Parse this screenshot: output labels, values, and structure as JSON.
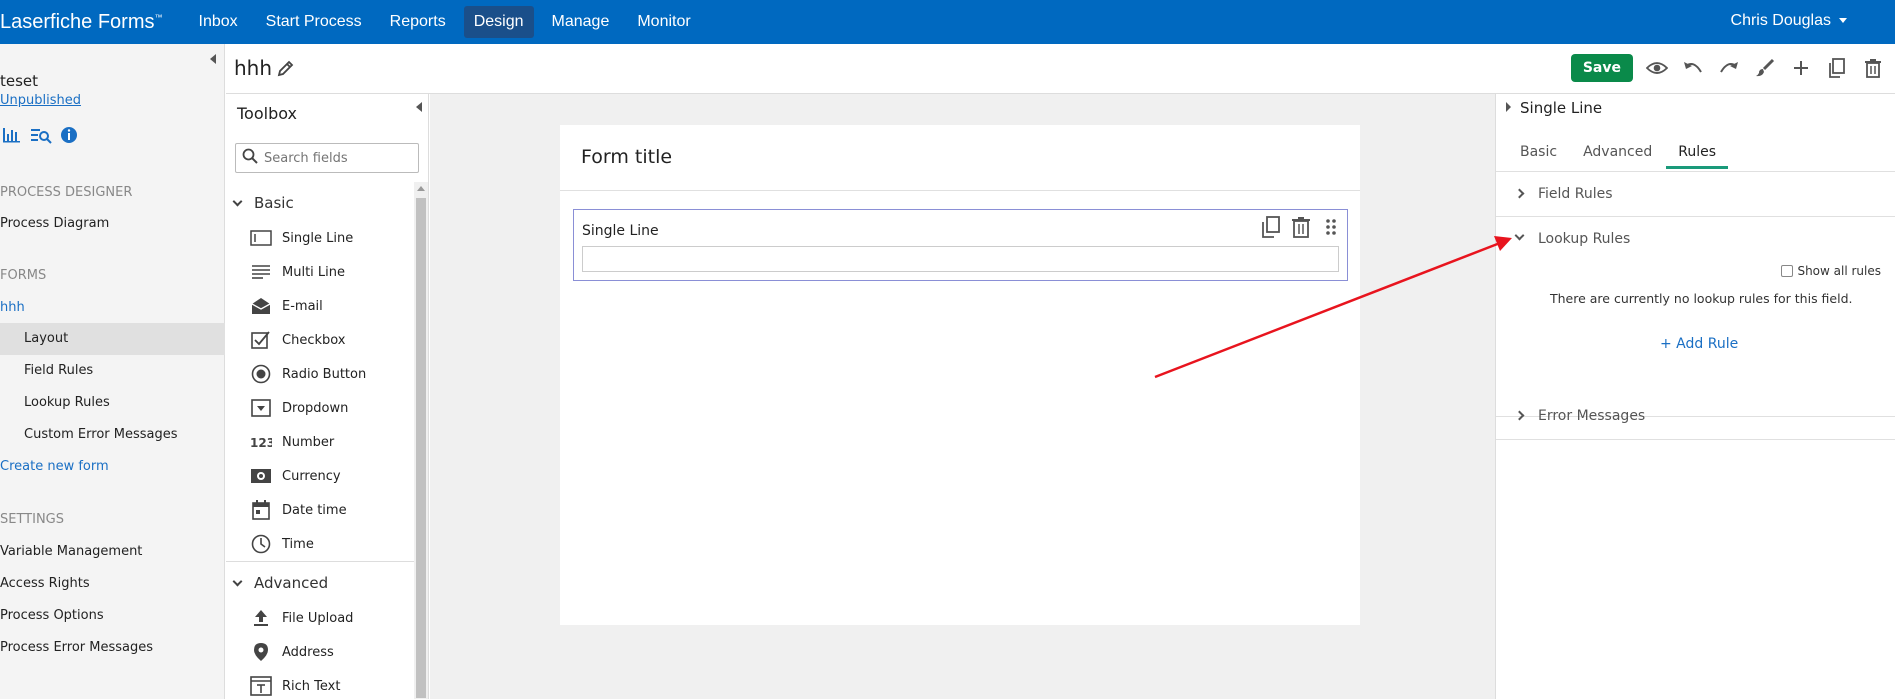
{
  "app": {
    "brand": "Laserfiche Forms",
    "trademark": "™",
    "nav": [
      "Inbox",
      "Start Process",
      "Reports",
      "Design",
      "Manage",
      "Monitor"
    ],
    "active_nav": "Design",
    "user": "Chris Douglas"
  },
  "sidebar": {
    "process_name": "teset",
    "status": "Unpublished",
    "process_designer_header": "PROCESS DESIGNER",
    "process_diagram": "Process Diagram",
    "forms_header": "FORMS",
    "form_link": "hhh",
    "form_items": [
      "Layout",
      "Field Rules",
      "Lookup Rules",
      "Custom Error Messages"
    ],
    "create_form": "Create new form",
    "settings_header": "SETTINGS",
    "settings_items": [
      "Variable Management",
      "Access Rights",
      "Process Options",
      "Process Error Messages"
    ]
  },
  "titlebar": {
    "form_name": "hhh",
    "save_label": "Save"
  },
  "toolbox": {
    "title": "Toolbox",
    "search_placeholder": "Search fields",
    "basic_group": "Basic",
    "basic_items": [
      {
        "label": "Single Line",
        "icon": "single-line-icon"
      },
      {
        "label": "Multi Line",
        "icon": "multi-line-icon"
      },
      {
        "label": "E-mail",
        "icon": "email-icon"
      },
      {
        "label": "Checkbox",
        "icon": "checkbox-icon"
      },
      {
        "label": "Radio Button",
        "icon": "radio-icon"
      },
      {
        "label": "Dropdown",
        "icon": "dropdown-icon"
      },
      {
        "label": "Number",
        "icon": "number-icon"
      },
      {
        "label": "Currency",
        "icon": "currency-icon"
      },
      {
        "label": "Date time",
        "icon": "calendar-icon"
      },
      {
        "label": "Time",
        "icon": "clock-icon"
      }
    ],
    "advanced_group": "Advanced",
    "advanced_items": [
      {
        "label": "File Upload",
        "icon": "upload-icon"
      },
      {
        "label": "Address",
        "icon": "location-icon"
      },
      {
        "label": "Rich Text",
        "icon": "rich-text-icon"
      }
    ]
  },
  "canvas": {
    "form_title": "Form title",
    "field_label": "Single Line"
  },
  "properties": {
    "title": "Single Line",
    "tabs": [
      "Basic",
      "Advanced",
      "Rules"
    ],
    "active_tab": "Rules",
    "field_rules": "Field Rules",
    "lookup_rules": "Lookup Rules",
    "show_all": "Show all rules",
    "no_rules": "There are currently no lookup rules for this field.",
    "add_rule": "+ Add Rule",
    "error_messages": "Error Messages"
  },
  "colors": {
    "topbar": "#0069c0",
    "save": "#0a8a4a",
    "link": "#1a6fc4",
    "tab_underline": "#1a9a7a",
    "annotation_arrow": "#e8141e"
  }
}
